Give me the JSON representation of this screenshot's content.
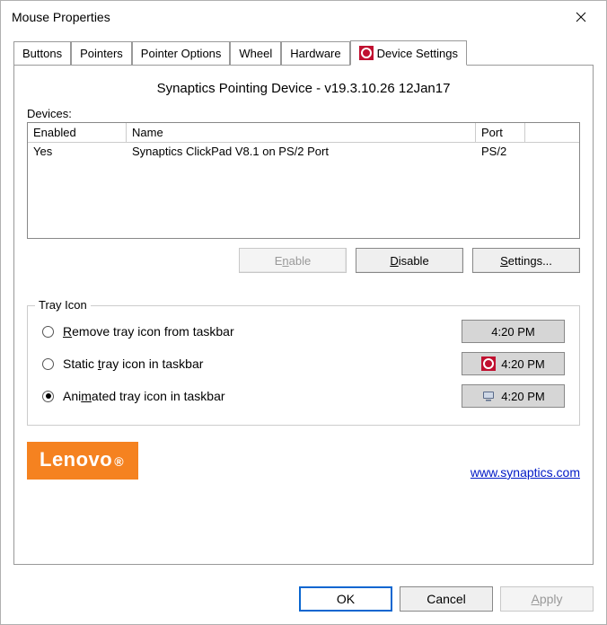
{
  "window": {
    "title": "Mouse Properties",
    "close": "✕"
  },
  "tabs": {
    "items": [
      {
        "label": "Buttons"
      },
      {
        "label": "Pointers"
      },
      {
        "label": "Pointer Options"
      },
      {
        "label": "Wheel"
      },
      {
        "label": "Hardware"
      },
      {
        "label": "Device Settings",
        "active": true
      }
    ]
  },
  "panel": {
    "version": "Synaptics Pointing Device - v19.3.10.26 12Jan17"
  },
  "devices": {
    "label": "Devices:",
    "headers": {
      "enabled": "Enabled",
      "name": "Name",
      "port": "Port"
    },
    "rows": [
      {
        "enabled": "Yes",
        "name": "Synaptics ClickPad V8.1 on PS/2 Port",
        "port": "PS/2"
      }
    ],
    "buttons": {
      "enable_pre": "E",
      "enable_ul": "n",
      "enable_post": "able",
      "disable_pre": "",
      "disable_ul": "D",
      "disable_post": "isable",
      "settings_pre": "",
      "settings_ul": "S",
      "settings_post": "ettings..."
    }
  },
  "tray": {
    "legend": "Tray Icon",
    "options": {
      "remove": {
        "pre": "",
        "ul": "R",
        "post": "emove tray icon from taskbar"
      },
      "static": {
        "pre": "Static ",
        "ul": "t",
        "post": "ray icon in taskbar"
      },
      "animated": {
        "pre": "Ani",
        "ul": "m",
        "post": "ated tray icon in taskbar"
      }
    },
    "previews": {
      "time": "4:20 PM"
    },
    "selected": "animated"
  },
  "brand": {
    "lenovo": "Lenovo",
    "lenovo_dot": "®",
    "link_text": "www.synaptics.com"
  },
  "dialog_buttons": {
    "ok": "OK",
    "cancel": "Cancel",
    "apply_pre": "",
    "apply_ul": "A",
    "apply_post": "pply"
  }
}
